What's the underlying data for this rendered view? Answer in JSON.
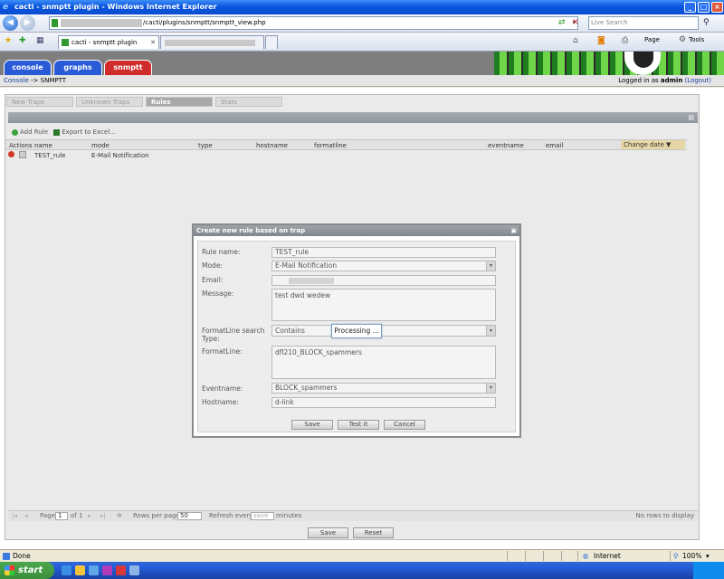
{
  "browser": {
    "window_title": "cacti - snmptt plugin - Windows Internet Explorer",
    "address_url": "/cacti/plugins/snmptt/snmptt_view.php",
    "search_placeholder": "Live Search",
    "tab_label": "cacti - snmptt plugin",
    "toolbar": {
      "page_label": "Page",
      "tools_label": "Tools"
    },
    "status": {
      "text": "Done",
      "zone": "Internet",
      "zoom": "100%"
    }
  },
  "cacti": {
    "nav_tabs": [
      {
        "label": "console",
        "color": "#2a5bd7"
      },
      {
        "label": "graphs",
        "color": "#2a5bd7"
      },
      {
        "label": "snmptt",
        "color": "#d12c2c"
      }
    ],
    "breadcrumb": {
      "root": "Console",
      "sep": " -> ",
      "current": "SNMPTT"
    },
    "login": {
      "prefix": "Logged in as ",
      "user": "admin",
      "logout": "(Logout)"
    }
  },
  "panel": {
    "tabs": [
      "New Traps",
      "Unknown Traps",
      "Rules",
      "Stats"
    ],
    "active_tab": "Rules",
    "toolbar": {
      "add_rule": "Add Rule",
      "export": "Export to Excel..."
    },
    "columns": [
      "Actions",
      "name",
      "mode",
      "type",
      "hostname",
      "formatline",
      "eventname",
      "email",
      "Change date ▼"
    ],
    "rows": [
      {
        "name": "TEST_rule",
        "mode": "E-Mail Notification"
      }
    ],
    "paging": {
      "page_label": "Page",
      "page_value": "1",
      "of_label": "of 1",
      "rows_label": "Rows per page:",
      "rows_value": "50",
      "refresh_label": "Refresh every",
      "refresh_value": "save",
      "minutes_label": "minutes",
      "no_rows": "No rows to display"
    },
    "buttons": {
      "save": "Save",
      "reset": "Reset"
    }
  },
  "modal": {
    "title": "Create new rule based on trap",
    "fields": {
      "rule_name_label": "Rule name:",
      "rule_name_value": "TEST_rule",
      "mode_label": "Mode:",
      "mode_value": "E-Mail Notification",
      "email_label": "Email:",
      "message_label": "Message:",
      "message_value": "test dwd  wedew",
      "search_type_label": "FormatLine search Type:",
      "search_type_value": "Contains",
      "formatline_label": "FormatLine:",
      "formatline_value": "dfl210_BLOCK_spammers",
      "eventname_label": "Eventname:",
      "eventname_value": "BLOCK_spammers",
      "hostname_label": "Hostname:",
      "hostname_value": "d-link"
    },
    "buttons": {
      "save": "Save",
      "test": "Test it",
      "cancel": "Cancel"
    },
    "processing": "Processing ..."
  },
  "taskbar": {
    "start_label": "start"
  }
}
